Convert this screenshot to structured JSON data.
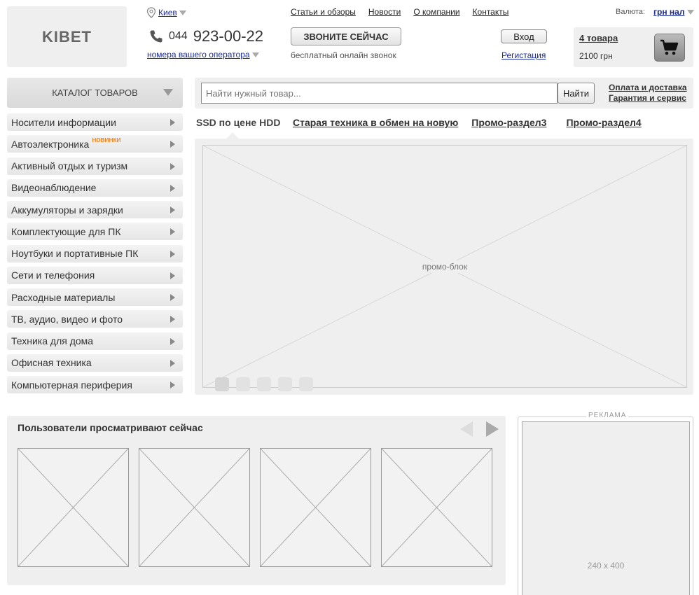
{
  "header": {
    "logo": "KIBET",
    "city": "Киев",
    "phone_code": "044",
    "phone_number": "923-00-22",
    "operator_link": "номера вашего оператора",
    "nav": [
      "Статьи и обзоры",
      "Новости",
      "О компании",
      "Контакты"
    ],
    "call_button": "ЗВОНИТЕ СЕЙЧАС",
    "call_subtitle": "бесплатный онлайн звонок",
    "login_button": "Вход",
    "register_link": "Регистация",
    "currency_label": "Валюта:",
    "currency_value": "грн нал",
    "cart_count": "4 товара",
    "cart_sum": "2100 грн"
  },
  "catalog": {
    "title": "КАТАЛОГ ТОВАРОВ",
    "items": [
      {
        "label": "Носители информации",
        "badge": ""
      },
      {
        "label": "Автоэлектроника",
        "badge": "новинки"
      },
      {
        "label": "Активный отдых и туризм",
        "badge": ""
      },
      {
        "label": "Видеонаблюдение",
        "badge": ""
      },
      {
        "label": "Аккумуляторы и зарядки",
        "badge": ""
      },
      {
        "label": "Комплектующие для ПК",
        "badge": ""
      },
      {
        "label": "Ноутбуки и портативные ПК",
        "badge": ""
      },
      {
        "label": "Сети и телефония",
        "badge": ""
      },
      {
        "label": "Расходные материалы",
        "badge": ""
      },
      {
        "label": "ТВ, аудио, видео и фото",
        "badge": ""
      },
      {
        "label": "Техника для дома",
        "badge": ""
      },
      {
        "label": "Офисная техника",
        "badge": ""
      },
      {
        "label": "Компьютерная периферия",
        "badge": ""
      }
    ]
  },
  "search": {
    "placeholder": "Найти нужный товар...",
    "button": "Найти",
    "links": [
      "Оплата и доставка",
      "Гарантия и сервис"
    ]
  },
  "promo": {
    "tabs": [
      "SSD по цене HDD",
      "Старая техника в обмен на новую",
      "Промо-раздел3",
      "Промо-раздел4"
    ],
    "label": "промо-блок"
  },
  "viewed": {
    "title": "Пользователи просматривают сейчас"
  },
  "ad": {
    "label": "РЕКЛАМА",
    "size": "240 x 400"
  },
  "icons": {
    "city": "map-pin-icon",
    "phone": "phone-icon",
    "cart": "cart-icon"
  }
}
